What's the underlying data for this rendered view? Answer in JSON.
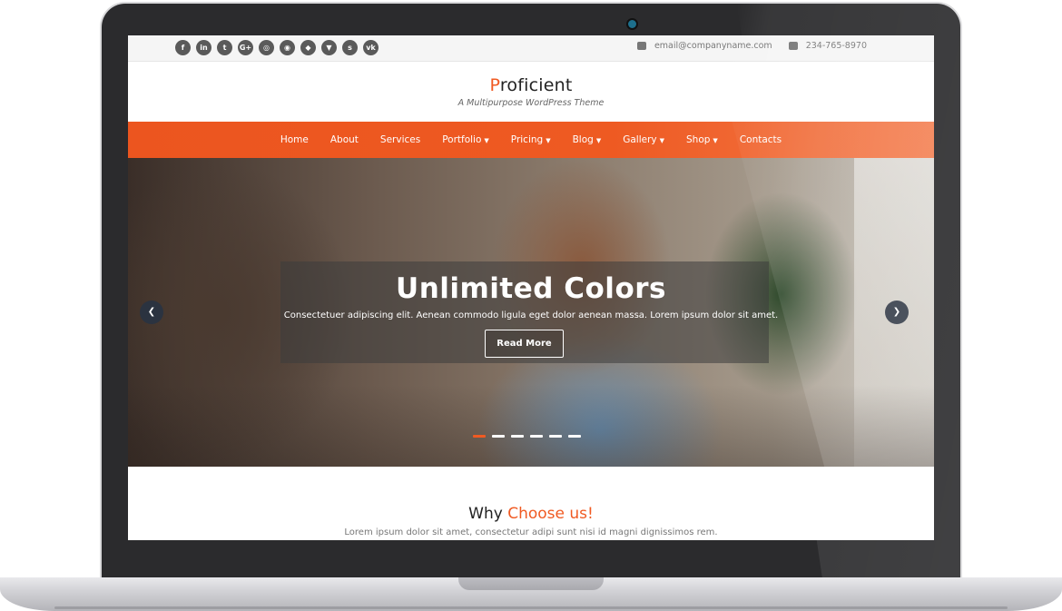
{
  "topbar": {
    "social_icons": [
      {
        "name": "facebook-icon",
        "glyph": "f"
      },
      {
        "name": "linkedin-icon",
        "glyph": "in"
      },
      {
        "name": "twitter-icon",
        "glyph": "t"
      },
      {
        "name": "google-plus-icon",
        "glyph": "G+"
      },
      {
        "name": "instagram-icon",
        "glyph": "◎"
      },
      {
        "name": "dribbble-icon",
        "glyph": "◉"
      },
      {
        "name": "github-icon",
        "glyph": "◆"
      },
      {
        "name": "foursquare-icon",
        "glyph": "▼"
      },
      {
        "name": "skype-icon",
        "glyph": "s"
      },
      {
        "name": "vk-icon",
        "glyph": "vk"
      }
    ],
    "email": "email@companyname.com",
    "phone": "234-765-8970"
  },
  "brand": {
    "logo_first_letter": "P",
    "logo_rest": "roficient",
    "tagline": "A Multipurpose WordPress Theme"
  },
  "nav": {
    "items": [
      {
        "label": "Home",
        "dropdown": false
      },
      {
        "label": "About",
        "dropdown": false
      },
      {
        "label": "Services",
        "dropdown": false
      },
      {
        "label": "Portfolio",
        "dropdown": true
      },
      {
        "label": "Pricing",
        "dropdown": true
      },
      {
        "label": "Blog",
        "dropdown": true
      },
      {
        "label": "Gallery",
        "dropdown": true
      },
      {
        "label": "Shop",
        "dropdown": true
      },
      {
        "label": "Contacts",
        "dropdown": false
      }
    ]
  },
  "hero": {
    "title": "Unlimited Colors",
    "text": "Consectetuer adipiscing elit. Aenean commodo ligula eget dolor aenean massa. Lorem ipsum dolor sit amet.",
    "button_label": "Read More",
    "slide_count": 6,
    "active_slide": 1
  },
  "why": {
    "title_plain": "Why ",
    "title_accent": "Choose us!",
    "text": "Lorem ipsum dolor sit amet, consectetur adipi sunt nisi id magni dignissimos rem."
  },
  "colors": {
    "accent": "#f05a22",
    "nav_bg": "#ee5a22",
    "text_dark": "#222222"
  }
}
